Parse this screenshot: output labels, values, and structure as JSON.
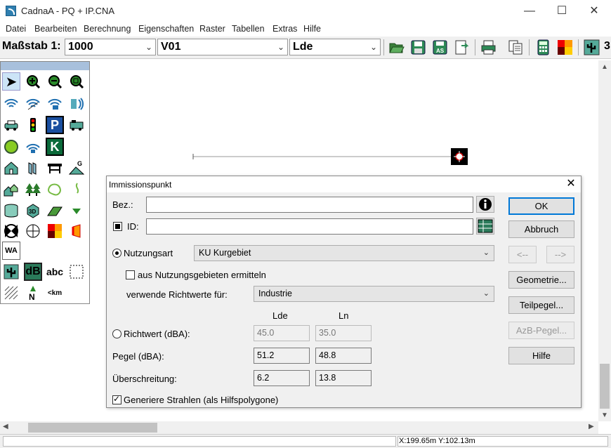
{
  "window": {
    "title": "CadnaA - PQ + IP.CNA",
    "minimize": "—",
    "maximize": "☐",
    "close": "✕"
  },
  "menu": [
    "Datei",
    "Bearbeiten",
    "Berechnung",
    "Eigenschaften",
    "Raster",
    "Tabellen",
    "Extras",
    "Hilfe"
  ],
  "toolbar": {
    "scale_label": "Maßstab 1:",
    "scale_value": "1000",
    "variant_value": "V01",
    "level_value": "Lde",
    "overflow_text": "3"
  },
  "palette": {
    "labels": {
      "wa": "WA",
      "db": "dB",
      "abc": "abc",
      "km": "km",
      "parking": "P",
      "k": "K",
      "threed": "3D"
    }
  },
  "dialog": {
    "title": "Immissionspunkt",
    "bez_label": "Bez.:",
    "bez_value": "",
    "id_label": "ID:",
    "id_value": "",
    "nutzungsart_label": "Nutzungsart",
    "nutzungsart_value": "KU Kurgebiet",
    "aus_nutzungsgebieten_label": "aus Nutzungsgebieten ermitteln",
    "richtwerte_label": "verwende Richtwerte für:",
    "richtwerte_value": "Industrie",
    "col_lde": "Lde",
    "col_ln": "Ln",
    "richtwert_label": "Richtwert (dBA):",
    "richtwert_lde": "45.0",
    "richtwert_ln": "35.0",
    "pegel_label": "Pegel (dBA):",
    "pegel_lde": "51.2",
    "pegel_ln": "48.8",
    "ueberschreitung_label": "Überschreitung:",
    "ueberschreitung_lde": "6.2",
    "ueberschreitung_ln": "13.8",
    "strahlen_label": "Generiere Strahlen (als Hilfspolygone)",
    "buttons": {
      "ok": "OK",
      "abbruch": "Abbruch",
      "prev": "<--",
      "next": "-->",
      "geometrie": "Geometrie...",
      "teilpegel": "Teilpegel...",
      "azb_pegel": "AzB-Pegel...",
      "hilfe": "Hilfe"
    }
  },
  "status": {
    "coords": "X:199.65m Y:102.13m"
  },
  "colors": {
    "accent": "#0078d7",
    "palette_header": "#a8c0dc"
  }
}
